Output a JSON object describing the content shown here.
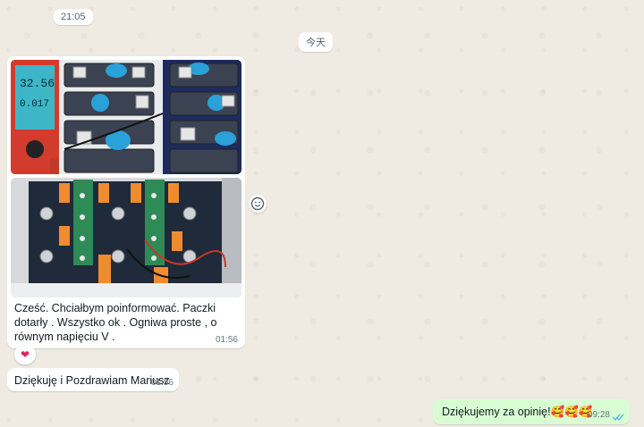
{
  "chat": {
    "time_chip": "21:05",
    "date_chip": "今天",
    "incoming_media": {
      "caption": "Cześć. Chciałbym poinformować. Paczki dotarły  . Wszystko ok . Ogniwa proste , o równym napięciu V .",
      "time": "01:56",
      "meter_reading_top": "32.56",
      "meter_reading_bottom": "0.017",
      "reaction": "❤"
    },
    "incoming_text": {
      "text": "Dziękuję i Pozdrawiam Mariusz",
      "time": "01:56"
    },
    "outgoing_text": {
      "text": "Dziękujemy za opinię!🥰🥰🥰",
      "time": "09:28",
      "status_icon": "double-check-read-icon"
    }
  },
  "colors": {
    "wallpaper": "#efeae2",
    "incoming_bubble": "#ffffff",
    "outgoing_bubble": "#d9fdd3",
    "read_ticks": "#53bdeb",
    "timestamp": "#667781"
  }
}
